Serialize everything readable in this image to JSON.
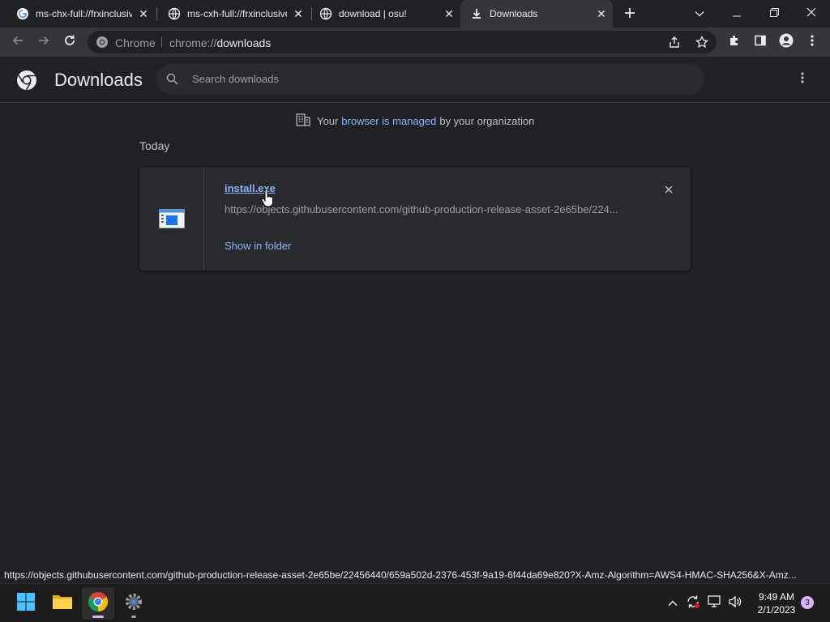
{
  "tabs": [
    {
      "title": "ms-chx-full://frxinclusive",
      "icon": "google-icon",
      "active": false
    },
    {
      "title": "ms-cxh-full://frxinclusive",
      "icon": "globe-icon",
      "active": false
    },
    {
      "title": "download | osu!",
      "icon": "globe-icon",
      "active": false
    },
    {
      "title": "Downloads",
      "icon": "download-icon",
      "active": true
    }
  ],
  "omnibox": {
    "site_label": "Chrome",
    "url_scheme": "chrome://",
    "url_host": "downloads"
  },
  "downloads": {
    "title": "Downloads",
    "search_placeholder": "Search downloads",
    "managed_prefix": "Your",
    "managed_link": "browser is managed",
    "managed_suffix": "by your organization",
    "section": "Today",
    "items": [
      {
        "file_name": "install.exe",
        "url": "https://objects.githubusercontent.com/github-production-release-asset-2e65be/224...",
        "action": "Show in folder"
      }
    ]
  },
  "status_url": "https://objects.githubusercontent.com/github-production-release-asset-2e65be/22456440/659a502d-2376-453f-9a19-6f44da69e820?X-Amz-Algorithm=AWS4-HMAC-SHA256&X-Amz...",
  "taskbar": {
    "clock_time": "9:49 AM",
    "clock_date": "2/1/2023",
    "notification_count": "3"
  },
  "colors": {
    "accent": "#8ab4f8",
    "background": "#202124",
    "toolbar": "#35363a"
  }
}
